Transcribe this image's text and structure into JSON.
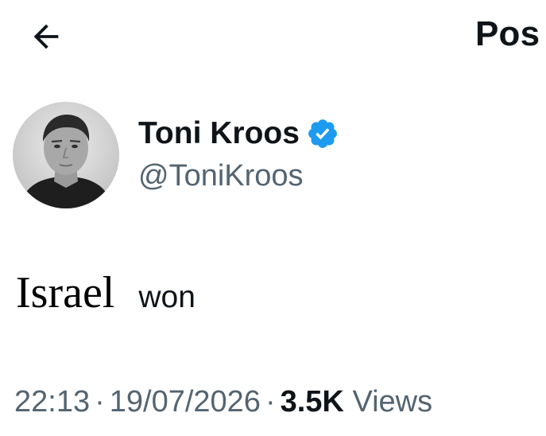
{
  "header": {
    "back_icon": "arrow-left-icon",
    "title": "Pos"
  },
  "author": {
    "display_name": "Toni Kroos",
    "handle": "@ToniKroos",
    "verified_icon": "verified-badge-icon",
    "verified_color": "#1d9bf0",
    "avatar_icon": "profile-photo"
  },
  "tweet": {
    "word1": "Israel",
    "word2": "won"
  },
  "meta": {
    "time": "22:13",
    "separator": "·",
    "date": "19/07/2026",
    "views_count": "3.5K",
    "views_label": "Views"
  },
  "colors": {
    "text_primary": "#0f1419",
    "text_secondary": "#536471",
    "background": "#ffffff"
  }
}
